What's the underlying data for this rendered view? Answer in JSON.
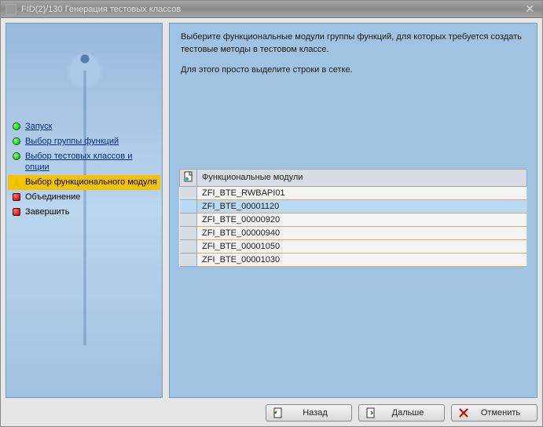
{
  "window": {
    "title": "FID(2)/130 Генерация тестовых классов"
  },
  "sidebar": {
    "steps": [
      {
        "label": "Запуск",
        "state": "done",
        "link": true
      },
      {
        "label": "Выбор группы функций",
        "state": "done",
        "link": true
      },
      {
        "label": "Выбор тестовых классов и опции",
        "state": "done",
        "link": true
      },
      {
        "label": "Выбор функционального модуля",
        "state": "current",
        "link": false
      },
      {
        "label": "Объединение",
        "state": "pending",
        "link": false
      },
      {
        "label": "Завершить",
        "state": "pending",
        "link": false
      }
    ]
  },
  "content": {
    "p1": "Выберите функциональные модули группы функций, для которых требуется создать тестовые методы в тестовом классе.",
    "p2": "Для этого просто выделите строки в сетке."
  },
  "grid": {
    "header": "Функциональные модули",
    "rows": [
      {
        "name": "ZFI_BTE_RWBAPI01",
        "selected": false
      },
      {
        "name": "ZFI_BTE_00001120",
        "selected": true
      },
      {
        "name": "ZFI_BTE_00000920",
        "selected": false
      },
      {
        "name": "ZFI_BTE_00000940",
        "selected": false
      },
      {
        "name": "ZFI_BTE_00001050",
        "selected": false
      },
      {
        "name": "ZFI_BTE_00001030",
        "selected": false
      }
    ]
  },
  "buttons": {
    "back": "Назад",
    "next": "Дальше",
    "cancel": "Отменить"
  }
}
